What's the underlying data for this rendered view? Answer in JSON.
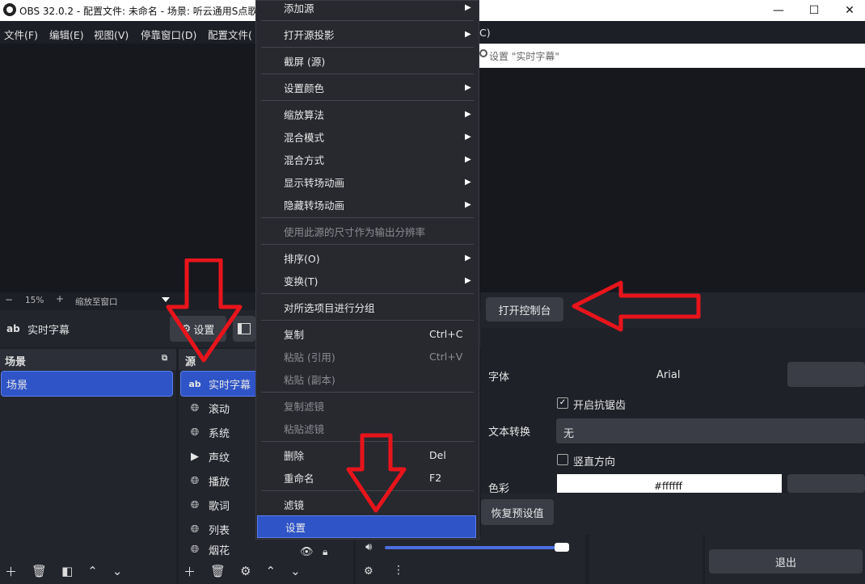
{
  "window": {
    "title": "OBS 32.0.2 - 配置文件: 未命名 - 场景: 听云通用S点歌",
    "minimize_glyph": "—",
    "maximize_glyph": "☐",
    "close_glyph": "✕"
  },
  "menubar": {
    "items": [
      "文件(F)",
      "编辑(E)",
      "视图(V)",
      "停靠窗口(D)",
      "配置文件("
    ],
    "partial_right": "C)"
  },
  "properties_header": {
    "title": "设置 \"实时字幕\""
  },
  "zoom": {
    "minus": "−",
    "level": "15%",
    "plus": "+",
    "fit_label": "缩放至窗口"
  },
  "source_toolbar": {
    "selected_source_icon": "ab",
    "selected_source_name": "实时字幕",
    "settings_button": "设置"
  },
  "scenes_dock": {
    "title": "场景",
    "items": [
      "场景"
    ]
  },
  "sources_dock": {
    "title": "源",
    "items": [
      {
        "icon": "ab",
        "name": "实时字幕"
      },
      {
        "icon": "globe",
        "name": "滚动"
      },
      {
        "icon": "globe",
        "name": "系统"
      },
      {
        "icon": "play",
        "name": "声纹"
      },
      {
        "icon": "globe",
        "name": "播放"
      },
      {
        "icon": "globe",
        "name": "歌词"
      },
      {
        "icon": "globe",
        "name": "列表"
      },
      {
        "icon": "globe",
        "name": "烟花"
      }
    ]
  },
  "properties": {
    "open_console_button": "打开控制台",
    "font_label": "字体",
    "font_value": "Arial",
    "antialias_label": "开启抗锯齿",
    "antialias_checked": true,
    "text_transform_label": "文本转换",
    "text_transform_value": "无",
    "vertical_label": "竖直方向",
    "vertical_checked": false,
    "color_label": "色彩",
    "color_value": "#ffffff",
    "restore_defaults_button": "恢复预设值"
  },
  "controls": {
    "exit_button": "退出"
  },
  "context_menu": {
    "items": [
      {
        "label": "添加源",
        "submenu": true
      },
      {
        "sep": true
      },
      {
        "label": "打开源投影",
        "submenu": true
      },
      {
        "sep": true
      },
      {
        "label": "截屏 (源)"
      },
      {
        "sep": true
      },
      {
        "label": "设置颜色",
        "submenu": true
      },
      {
        "sep": true
      },
      {
        "label": "缩放算法",
        "submenu": true
      },
      {
        "label": "混合模式",
        "submenu": true
      },
      {
        "label": "混合方式",
        "submenu": true
      },
      {
        "label": "显示转场动画",
        "submenu": true
      },
      {
        "label": "隐藏转场动画",
        "submenu": true
      },
      {
        "sep": true
      },
      {
        "label": "使用此源的尺寸作为输出分辨率",
        "disabled": true
      },
      {
        "sep": true
      },
      {
        "label": "排序(O)",
        "submenu": true
      },
      {
        "label": "变换(T)",
        "submenu": true
      },
      {
        "sep": true
      },
      {
        "label": "对所选项目进行分组"
      },
      {
        "sep": true
      },
      {
        "label": "复制",
        "shortcut": "Ctrl+C"
      },
      {
        "label": "粘贴 (引用)",
        "shortcut": "Ctrl+V",
        "disabled": true
      },
      {
        "label": "粘贴 (副本)",
        "disabled": true
      },
      {
        "sep": true
      },
      {
        "label": "复制滤镜",
        "disabled": true
      },
      {
        "label": "粘贴滤镜",
        "disabled": true
      },
      {
        "sep": true
      },
      {
        "label": "删除",
        "shortcut": "Del"
      },
      {
        "label": "重命名",
        "shortcut": "F2"
      },
      {
        "sep": true
      },
      {
        "label": "滤镜"
      },
      {
        "label": "设置",
        "highlighted": true
      }
    ]
  },
  "colors": {
    "accent": "#2f54c7",
    "annotation_red": "#e8141b"
  }
}
